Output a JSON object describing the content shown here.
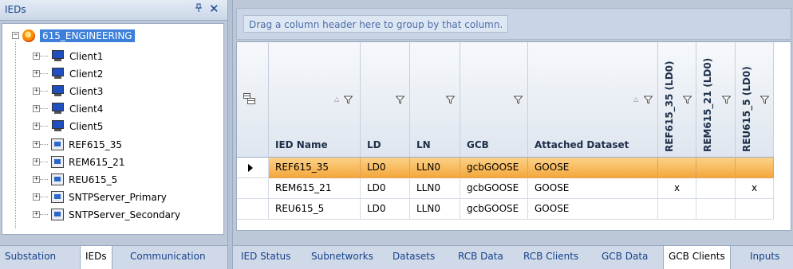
{
  "left_panel": {
    "title": "IEDs",
    "pin_icon": "pin-icon",
    "close_icon": "close-icon",
    "tree": {
      "root": {
        "label": "615_ENGINEERING",
        "icon": "engineering-icon"
      },
      "children": [
        {
          "label": "Client1",
          "icon": "monitor-icon"
        },
        {
          "label": "Client2",
          "icon": "monitor-icon"
        },
        {
          "label": "Client3",
          "icon": "monitor-icon"
        },
        {
          "label": "Client4",
          "icon": "monitor-icon"
        },
        {
          "label": "Client5",
          "icon": "monitor-icon"
        },
        {
          "label": "REF615_35",
          "icon": "ied-device-icon"
        },
        {
          "label": "REM615_21",
          "icon": "ied-device-icon"
        },
        {
          "label": "REU615_5",
          "icon": "ied-device-icon"
        },
        {
          "label": "SNTPServer_Primary",
          "icon": "ied-device-icon"
        },
        {
          "label": "SNTPServer_Secondary",
          "icon": "ied-device-icon"
        }
      ]
    },
    "tabs": [
      "Substation",
      "IEDs",
      "Communication"
    ],
    "active_tab": "IEDs"
  },
  "grid": {
    "group_hint": "Drag a column header here to group by that column.",
    "columns": [
      "IED Name",
      "LD",
      "LN",
      "GCB",
      "Attached Dataset",
      "REF615_35 (LD0)",
      "REM615_21 (LD0)",
      "REU615_5 (LD0)"
    ],
    "rows": [
      {
        "cells": [
          "REF615_35",
          "LD0",
          "LLN0",
          "gcbGOOSE",
          "GOOSE",
          "",
          "",
          ""
        ],
        "selected": true
      },
      {
        "cells": [
          "REM615_21",
          "LD0",
          "LLN0",
          "gcbGOOSE",
          "GOOSE",
          "x",
          "",
          "x"
        ],
        "selected": false
      },
      {
        "cells": [
          "REU615_5",
          "LD0",
          "LLN0",
          "gcbGOOSE",
          "GOOSE",
          "",
          "",
          ""
        ],
        "selected": false
      }
    ]
  },
  "bottom_tabs": [
    "IED Status",
    "Subnetworks",
    "Datasets",
    "RCB Data",
    "RCB Clients",
    "GCB Data",
    "GCB Clients",
    "Inputs"
  ],
  "active_bottom_tab": "GCB Clients",
  "colors": {
    "selection_highlight": "#3e80d9",
    "selected_row_gradient_top": "#fcd287",
    "selected_row_gradient_bottom": "#f4a73c",
    "header_text": "#15428b"
  }
}
